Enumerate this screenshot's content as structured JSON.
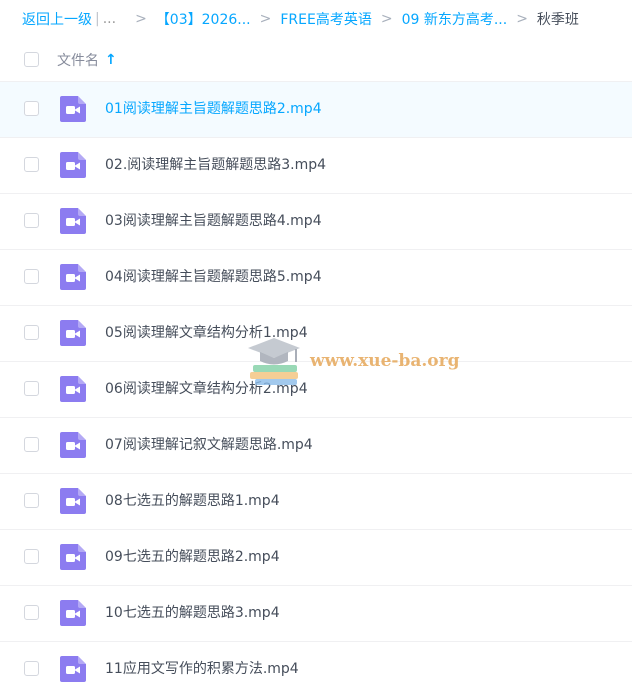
{
  "breadcrumb": {
    "back_label": "返回上一级",
    "pipe": "|",
    "ellipsis": "...",
    "separator": ">",
    "items": [
      {
        "label": "【03】2026..."
      },
      {
        "label": "FREE高考英语"
      },
      {
        "label": "09 新东方高考..."
      }
    ],
    "current": "秋季班"
  },
  "header": {
    "column_label": "文件名",
    "sort_arrow": "↑"
  },
  "files": [
    {
      "name": "01阅读理解主旨题解题思路2.mp4",
      "selected": true
    },
    {
      "name": "02.阅读理解主旨题解题思路3.mp4",
      "selected": false
    },
    {
      "name": "03阅读理解主旨题解题思路4.mp4",
      "selected": false
    },
    {
      "name": "04阅读理解主旨题解题思路5.mp4",
      "selected": false
    },
    {
      "name": "05阅读理解文章结构分析1.mp4",
      "selected": false
    },
    {
      "name": "06阅读理解文章结构分析2.mp4",
      "selected": false
    },
    {
      "name": "07阅读理解记叙文解题思路.mp4",
      "selected": false
    },
    {
      "name": "08七选五的解题思路1.mp4",
      "selected": false
    },
    {
      "name": "09七选五的解题思路2.mp4",
      "selected": false
    },
    {
      "name": "10七选五的解题思路3.mp4",
      "selected": false
    },
    {
      "name": "11应用文写作的积累方法.mp4",
      "selected": false
    }
  ],
  "file_icon": "video-file-icon",
  "colors": {
    "accent": "#06a7ff",
    "video_icon": "#8c7cf0",
    "selected_row": "#f4fbff",
    "text": "#454d5a"
  },
  "watermark": {
    "text": "www.xue-ba.org"
  }
}
